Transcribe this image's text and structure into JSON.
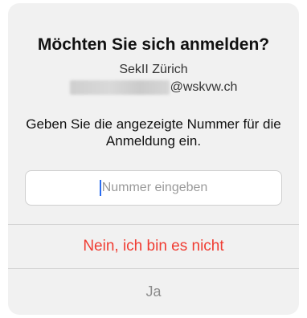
{
  "dialog": {
    "title": "Möchten Sie sich anmelden?",
    "organization": "SekII Zürich",
    "account_domain": "@wskvw.ch",
    "instruction": "Geben Sie die angezeigte Nummer für die Anmeldung ein.",
    "number_input": {
      "value": "",
      "placeholder": "Nummer eingeben"
    },
    "deny_label": "Nein, ich bin es nicht",
    "approve_label": "Ja"
  },
  "colors": {
    "dialog_background": "#f1f1f1",
    "deny_text": "#f03c32",
    "approve_text_disabled": "#8c8c8c",
    "caret": "#2a6cf0"
  }
}
